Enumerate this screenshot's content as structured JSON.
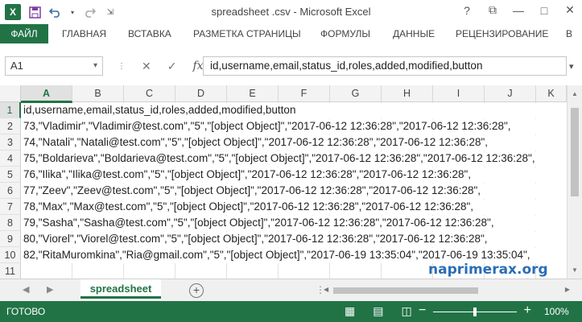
{
  "window": {
    "title": "spreadsheet .csv - Microsoft Excel",
    "qat_icons": [
      "excel-logo",
      "save-icon",
      "undo-icon",
      "redo-icon",
      "customize-icon"
    ],
    "controls": {
      "help": "?",
      "restore": "⧉",
      "minimize": "—",
      "maximize": "□",
      "close": "✕"
    }
  },
  "ribbon": {
    "tabs": [
      "ФАЙЛ",
      "ГЛАВНАЯ",
      "ВСТАВКА",
      "РАЗМЕТКА СТРАНИЦЫ",
      "ФОРМУЛЫ",
      "ДАННЫЕ",
      "РЕЦЕНЗИРОВАНИЕ",
      "В"
    ]
  },
  "formula_bar": {
    "name_box": "A1",
    "fx": "fx",
    "formula": "id,username,email,status_id,roles,added,modified,button"
  },
  "grid": {
    "columns": [
      "A",
      "B",
      "C",
      "D",
      "E",
      "F",
      "G",
      "H",
      "I",
      "J",
      "K"
    ],
    "rows": [
      "1",
      "2",
      "3",
      "4",
      "5",
      "6",
      "7",
      "8",
      "9",
      "10",
      "11"
    ],
    "cells": [
      "id,username,email,status_id,roles,added,modified,button",
      "73,\"Vladimir\",\"Vladimir@test.com\",\"5\",\"[object Object]\",\"2017-06-12 12:36:28\",\"2017-06-12 12:36:28\",",
      "74,\"Natali\",\"Natali@test.com\",\"5\",\"[object Object]\",\"2017-06-12 12:36:28\",\"2017-06-12 12:36:28\",",
      "75,\"Boldarieva\",\"Boldarieva@test.com\",\"5\",\"[object Object]\",\"2017-06-12 12:36:28\",\"2017-06-12 12:36:28\",",
      "76,\"Ilika\",\"Ilika@test.com\",\"5\",\"[object Object]\",\"2017-06-12 12:36:28\",\"2017-06-12 12:36:28\",",
      "77,\"Zeev\",\"Zeev@test.com\",\"5\",\"[object Object]\",\"2017-06-12 12:36:28\",\"2017-06-12 12:36:28\",",
      "78,\"Max\",\"Max@test.com\",\"5\",\"[object Object]\",\"2017-06-12 12:36:28\",\"2017-06-12 12:36:28\",",
      "79,\"Sasha\",\"Sasha@test.com\",\"5\",\"[object Object]\",\"2017-06-12 12:36:28\",\"2017-06-12 12:36:28\",",
      "80,\"Viorel\",\"Viorel@test.com\",\"5\",\"[object Object]\",\"2017-06-12 12:36:28\",\"2017-06-12 12:36:28\",",
      "82,\"RitaMuromkina\",\"Ria@gmail.com\",\"5\",\"[object Object]\",\"2017-06-19 13:35:04\",\"2017-06-19 13:35:04\",",
      ""
    ]
  },
  "watermark": "naprimerax.org",
  "sheets": {
    "active": "spreadsheet",
    "add_label": "+"
  },
  "status_bar": {
    "status": "ГОТОВО",
    "zoom": "100%",
    "zoom_level_percent": 100
  },
  "colors": {
    "accent": "#217346",
    "watermark": "#2a6db5"
  }
}
